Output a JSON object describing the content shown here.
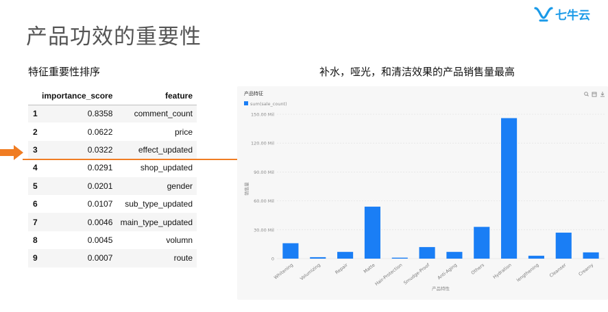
{
  "logo": {
    "text": "七牛云",
    "color": "#1a9ae8"
  },
  "title": "产品功效的重要性",
  "left_heading": "特征重要性排序",
  "right_heading": "补水，哑光，和清洁效果的产品销售量最高",
  "table": {
    "headers": [
      "",
      "importance_score",
      "feature"
    ],
    "rows": [
      {
        "idx": "1",
        "score": "0.8358",
        "feature": "comment_count"
      },
      {
        "idx": "2",
        "score": "0.0622",
        "feature": "price"
      },
      {
        "idx": "3",
        "score": "0.0322",
        "feature": "effect_updated"
      },
      {
        "idx": "4",
        "score": "0.0291",
        "feature": "shop_updated"
      },
      {
        "idx": "5",
        "score": "0.0201",
        "feature": "gender"
      },
      {
        "idx": "6",
        "score": "0.0107",
        "feature": "sub_type_updated"
      },
      {
        "idx": "7",
        "score": "0.0046",
        "feature": "main_type_updated"
      },
      {
        "idx": "8",
        "score": "0.0045",
        "feature": "volumn"
      },
      {
        "idx": "9",
        "score": "0.0007",
        "feature": "route"
      }
    ],
    "highlight_row": "3",
    "highlight_color": "#f07c22"
  },
  "chart_data": {
    "type": "bar",
    "title": "产品特征",
    "legend": [
      "sum(sale_count)"
    ],
    "legend_position": "top-left",
    "xlabel": "产品特性",
    "ylabel": "销售量",
    "bar_color": "#1a7ef5",
    "ylim": [
      0,
      150
    ],
    "yticks": [
      0,
      30,
      60,
      90,
      120,
      150
    ],
    "ytick_labels": [
      "0",
      "30.00 Mil",
      "60.00 Mil",
      "90.00 Mil",
      "120.00 Mil",
      "150.00 Mil"
    ],
    "categories": [
      "Whitening",
      "Volumizing",
      "Repair",
      "Matte",
      "Hair-Protection",
      "Smudge-Proof",
      "Anti-Aging",
      "Others",
      "Hydration",
      "lengthening",
      "Cleanser",
      "Creamy"
    ],
    "series": [
      {
        "name": "sum(sale_count)",
        "values": [
          16,
          1.5,
          7,
          54,
          1,
          12,
          7,
          33,
          146,
          3,
          27,
          6.5
        ]
      }
    ],
    "grid": true,
    "toolbar_icons": [
      "search-icon",
      "calendar-icon",
      "download-icon"
    ]
  }
}
